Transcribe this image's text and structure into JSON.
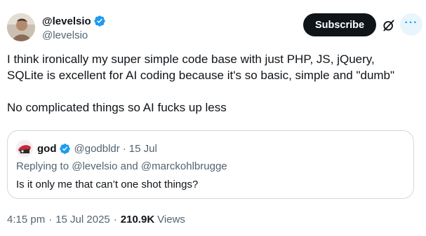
{
  "author": {
    "display_name": "@levelsio",
    "handle": "@levelsio",
    "avatar_icon": "profile-photo",
    "verified_icon": "verified-badge-icon"
  },
  "actions": {
    "subscribe_label": "Subscribe",
    "grok_icon": "grok-icon",
    "more_icon": "more-icon",
    "more_glyph": "···"
  },
  "tweet": {
    "line1": "I think ironically my super simple code base with just PHP, JS, jQuery,",
    "line2": "SQLite is excellent for AI coding because it's so basic, simple and \"dumb\"",
    "line3": "No complicated things so AI fucks up less"
  },
  "quote": {
    "display_name": "god",
    "handle": "@godbldr",
    "separator": "·",
    "date": "15 Jul",
    "replying_prefix": "Replying to",
    "replying_user1": "@levelsio",
    "replying_and": "and",
    "replying_user2": "@marckohlbrugge",
    "body": "Is it only me that can’t one shot things?"
  },
  "meta": {
    "time": "4:15 pm",
    "separator": "·",
    "date": "15 Jul 2025",
    "views_count": "210.9K",
    "views_label": "Views"
  },
  "colors": {
    "text_primary": "#0f1419",
    "text_secondary": "#536471",
    "accent_blue": "#1d9bf0",
    "button_dark": "#0f1419",
    "border": "#cfd9de"
  }
}
